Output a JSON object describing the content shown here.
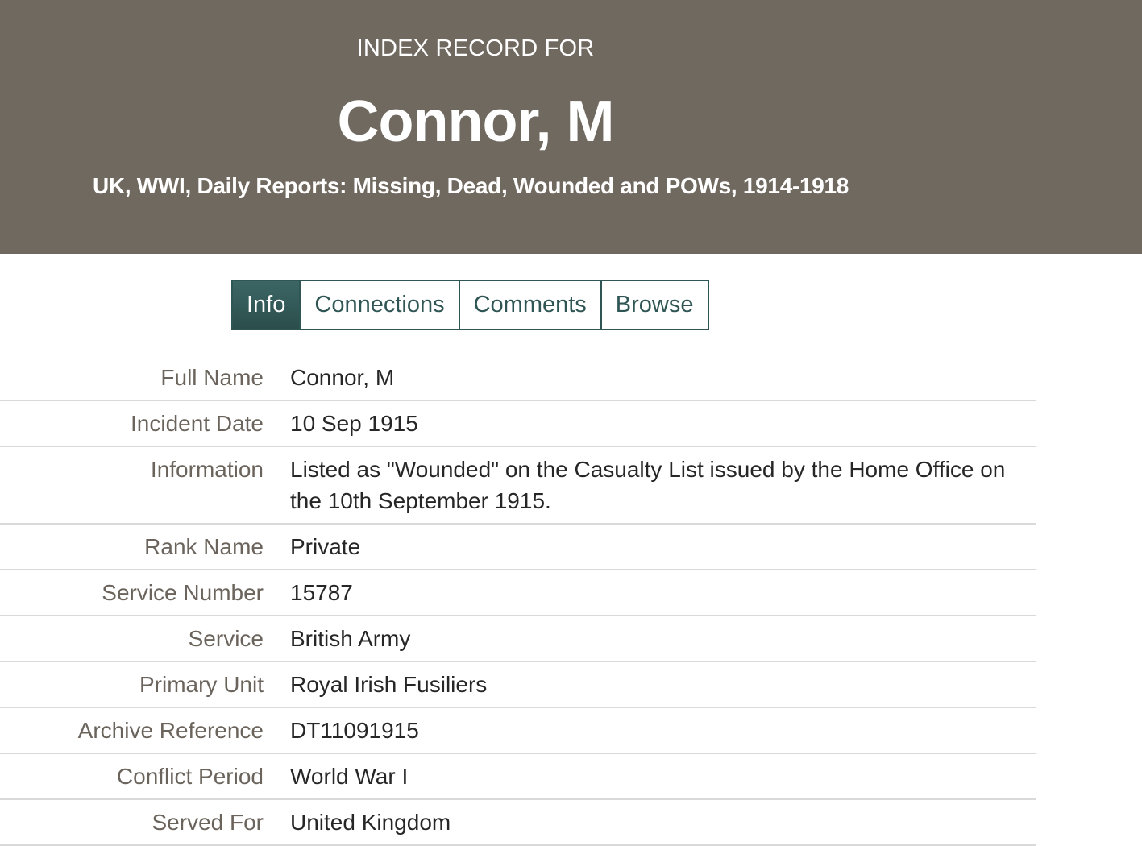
{
  "header": {
    "eyebrow": "INDEX RECORD FOR",
    "name": "Connor, M",
    "collection": "UK, WWI, Daily Reports: Missing, Dead, Wounded and POWs, 1914-1918"
  },
  "tabs": [
    {
      "label": "Info",
      "active": true
    },
    {
      "label": "Connections",
      "active": false
    },
    {
      "label": "Comments",
      "active": false
    },
    {
      "label": "Browse",
      "active": false
    }
  ],
  "record": {
    "full_name": {
      "label": "Full Name",
      "value": "Connor, M"
    },
    "incident_date": {
      "label": "Incident Date",
      "value": "10 Sep 1915"
    },
    "information": {
      "label": "Information",
      "value": "Listed as \"Wounded\" on the Casualty List issued by the Home Office on the 10th September 1915."
    },
    "rank_name": {
      "label": "Rank Name",
      "value": "Private"
    },
    "service_number": {
      "label": "Service Number",
      "value": "15787"
    },
    "service": {
      "label": "Service",
      "value": "British Army"
    },
    "primary_unit": {
      "label": "Primary Unit",
      "value": "Royal Irish Fusiliers"
    },
    "archive_reference": {
      "label": "Archive Reference",
      "value": "DT11091915"
    },
    "conflict_period": {
      "label": "Conflict Period",
      "value": "World War I"
    },
    "served_for": {
      "label": "Served For",
      "value": "United Kingdom"
    }
  },
  "colors": {
    "header_bg": "#706960",
    "accent": "#2f5654",
    "label_text": "#6b645c",
    "value_text": "#262626",
    "divider": "#d9d9d9"
  }
}
